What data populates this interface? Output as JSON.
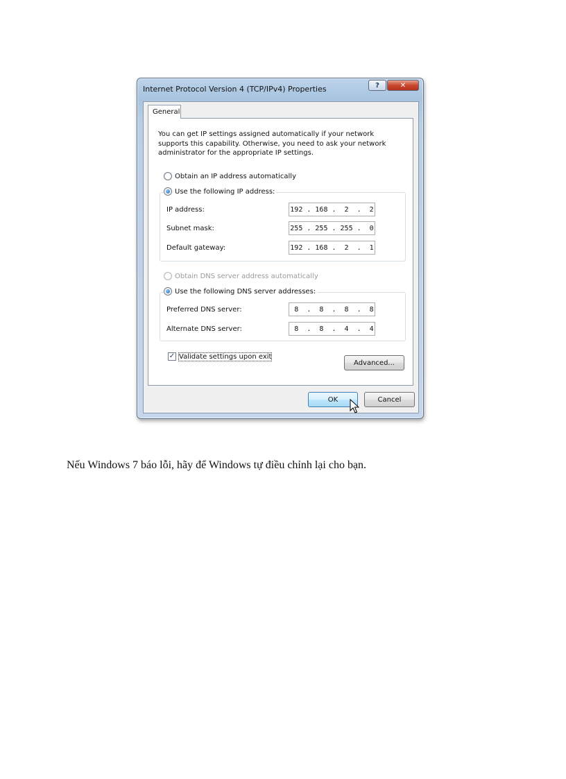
{
  "dialog": {
    "title": "Internet Protocol Version 4 (TCP/IPv4) Properties",
    "help_label": "?",
    "close_label": "✕",
    "tab_label": "General",
    "intro_text": "You can get IP settings assigned automatically if your network supports this capability. Otherwise, you need to ask your network administrator for the appropriate IP settings.",
    "ip_auto_label": "Obtain an IP address automatically",
    "ip_manual_label": "Use the following IP address:",
    "ip_address_label": "IP address:",
    "ip_address_value": "192 . 168 .  2  .  2",
    "subnet_label": "Subnet mask:",
    "subnet_value": "255 . 255 . 255 .  0",
    "gateway_label": "Default gateway:",
    "gateway_value": "192 . 168 .  2  .  1",
    "dns_auto_label": "Obtain DNS server address automatically",
    "dns_manual_label": "Use the following DNS server addresses:",
    "preferred_dns_label": "Preferred DNS server:",
    "preferred_dns_value": " 8  .  8  .  8  .  8",
    "alternate_dns_label": "Alternate DNS server:",
    "alternate_dns_value": " 8  .  8  .  4  .  4",
    "validate_label": "Validate settings upon exit",
    "validate_checked": true,
    "advanced_label": "Advanced...",
    "ok_label": "OK",
    "cancel_label": "Cancel"
  },
  "caption": "Nếu Windows 7 báo lỗi, hãy để Windows tự điều chỉnh lại cho bạn."
}
